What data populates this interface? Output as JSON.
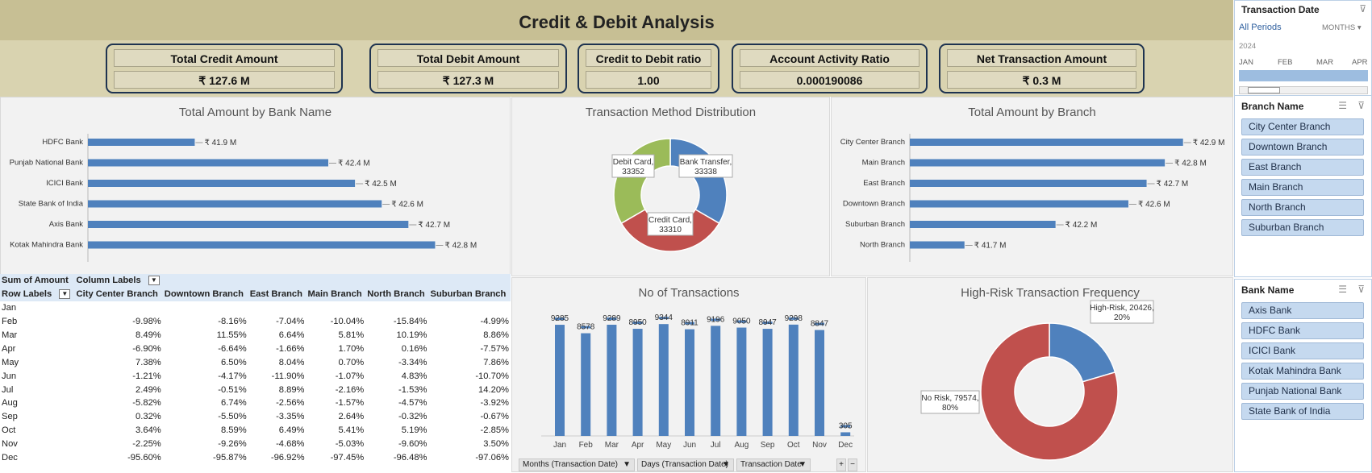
{
  "title": "Credit & Debit Analysis",
  "kpis": [
    {
      "label": "Total Credit Amount",
      "value": "₹ 127.6 M"
    },
    {
      "label": "Total Debit Amount",
      "value": "₹ 127.3 M"
    },
    {
      "label": "Credit to Debit ratio",
      "value": "1.00"
    },
    {
      "label": "Account Activity Ratio",
      "value": "0.000190086"
    },
    {
      "label": "Net Transaction Amount",
      "value": "₹ 0.3 M"
    }
  ],
  "colors": {
    "blue": "#4f81bd",
    "red": "#c0504d",
    "green": "#9bbb59"
  },
  "charts": {
    "bank": {
      "title": "Total Amount by Bank Name"
    },
    "method": {
      "title": "Transaction Method Distribution"
    },
    "branch": {
      "title": "Total Amount by Branch"
    },
    "count": {
      "title": "No of Transactions"
    },
    "risk": {
      "title": "High-Risk Transaction Frequency"
    }
  },
  "chart_data": [
    {
      "type": "bar",
      "orientation": "horizontal",
      "title": "Total Amount by Bank Name",
      "categories": [
        "HDFC Bank",
        "Punjab National Bank",
        "ICICI Bank",
        "State Bank of India",
        "Axis Bank",
        "Kotak Mahindra Bank"
      ],
      "values": [
        41.9,
        42.4,
        42.5,
        42.6,
        42.7,
        42.8
      ],
      "labels": [
        "₹ 41.9 M",
        "₹ 42.4 M",
        "₹ 42.5 M",
        "₹ 42.6 M",
        "₹ 42.7 M",
        "₹ 42.8 M"
      ],
      "xlim": [
        41.5,
        42.85
      ]
    },
    {
      "type": "pie",
      "donut": true,
      "title": "Transaction Method Distribution",
      "slices": [
        {
          "name": "Bank Transfer",
          "value": 33338,
          "label1": "Bank Transfer,",
          "label2": "33338"
        },
        {
          "name": "Credit Card",
          "value": 33310,
          "label1": "Credit Card,",
          "label2": "33310"
        },
        {
          "name": "Debit Card",
          "value": 33352,
          "label1": "Debit Card,",
          "label2": "33352"
        }
      ]
    },
    {
      "type": "bar",
      "orientation": "horizontal",
      "title": "Total Amount by Branch",
      "categories": [
        "City Center Branch",
        "Main Branch",
        "East Branch",
        "Downtown Branch",
        "Suburban Branch",
        "North Branch"
      ],
      "values": [
        42.9,
        42.8,
        42.7,
        42.6,
        42.2,
        41.7
      ],
      "labels": [
        "₹ 42.9 M",
        "₹ 42.8 M",
        "₹ 42.7 M",
        "₹ 42.6 M",
        "₹ 42.2 M",
        "₹ 41.7 M"
      ],
      "xlim": [
        41.4,
        42.95
      ]
    },
    {
      "type": "bar",
      "title": "No of Transactions",
      "categories": [
        "Jan",
        "Feb",
        "Mar",
        "Apr",
        "May",
        "Jun",
        "Jul",
        "Aug",
        "Sep",
        "Oct",
        "Nov",
        "Dec"
      ],
      "values": [
        9285,
        8578,
        9289,
        8950,
        9344,
        8911,
        9196,
        9050,
        8947,
        9298,
        8847,
        305
      ],
      "ylim": [
        0,
        10500
      ]
    },
    {
      "type": "pie",
      "donut": true,
      "title": "High-Risk Transaction Frequency",
      "slices": [
        {
          "name": "High-Risk",
          "value": 20426,
          "label1": "High-Risk, 20426,",
          "label2": "20%"
        },
        {
          "name": "No Risk",
          "value": 79574,
          "label1": "No Risk, 79574,",
          "label2": "80%"
        }
      ]
    }
  ],
  "pivot": {
    "corner": "Sum of Amount",
    "col_labels": "Column Labels",
    "row_labels": "Row Labels",
    "columns": [
      "City Center Branch",
      "Downtown Branch",
      "East Branch",
      "Main Branch",
      "North Branch",
      "Suburban Branch"
    ],
    "rows": [
      {
        "m": "Jan",
        "v": [
          "",
          "",
          "",
          "",
          "",
          ""
        ]
      },
      {
        "m": "Feb",
        "v": [
          "-9.98%",
          "-8.16%",
          "-7.04%",
          "-10.04%",
          "-15.84%",
          "-4.99%"
        ]
      },
      {
        "m": "Mar",
        "v": [
          "8.49%",
          "11.55%",
          "6.64%",
          "5.81%",
          "10.19%",
          "8.86%"
        ]
      },
      {
        "m": "Apr",
        "v": [
          "-6.90%",
          "-6.64%",
          "-1.66%",
          "1.70%",
          "0.16%",
          "-7.57%"
        ]
      },
      {
        "m": "May",
        "v": [
          "7.38%",
          "6.50%",
          "8.04%",
          "0.70%",
          "-3.34%",
          "7.86%"
        ]
      },
      {
        "m": "Jun",
        "v": [
          "-1.21%",
          "-4.17%",
          "-11.90%",
          "-1.07%",
          "4.83%",
          "-10.70%"
        ]
      },
      {
        "m": "Jul",
        "v": [
          "2.49%",
          "-0.51%",
          "8.89%",
          "-2.16%",
          "-1.53%",
          "14.20%"
        ]
      },
      {
        "m": "Aug",
        "v": [
          "-5.82%",
          "6.74%",
          "-2.56%",
          "-1.57%",
          "-4.57%",
          "-3.92%"
        ]
      },
      {
        "m": "Sep",
        "v": [
          "0.32%",
          "-5.50%",
          "-3.35%",
          "2.64%",
          "-0.32%",
          "-0.67%"
        ]
      },
      {
        "m": "Oct",
        "v": [
          "3.64%",
          "8.59%",
          "6.49%",
          "5.41%",
          "5.19%",
          "-2.85%"
        ]
      },
      {
        "m": "Nov",
        "v": [
          "-2.25%",
          "-9.26%",
          "-4.68%",
          "-5.03%",
          "-9.60%",
          "3.50%"
        ]
      },
      {
        "m": "Dec",
        "v": [
          "-95.60%",
          "-95.87%",
          "-96.92%",
          "-97.45%",
          "-96.48%",
          "-97.06%"
        ]
      }
    ]
  },
  "filter_bar": [
    "Months (Transaction Date)",
    "Days (Transaction Date)",
    "Transaction Date"
  ],
  "timeline": {
    "title": "Transaction Date",
    "all_periods": "All Periods",
    "unit": "MONTHS",
    "year": "2024",
    "months": [
      "JAN",
      "FEB",
      "MAR",
      "APR"
    ]
  },
  "slicers": {
    "branch": {
      "title": "Branch Name",
      "items": [
        "City Center Branch",
        "Downtown Branch",
        "East Branch",
        "Main Branch",
        "North Branch",
        "Suburban Branch"
      ]
    },
    "bank": {
      "title": "Bank Name",
      "items": [
        "Axis Bank",
        "HDFC Bank",
        "ICICI Bank",
        "Kotak Mahindra Bank",
        "Punjab National Bank",
        "State Bank of India"
      ]
    }
  }
}
